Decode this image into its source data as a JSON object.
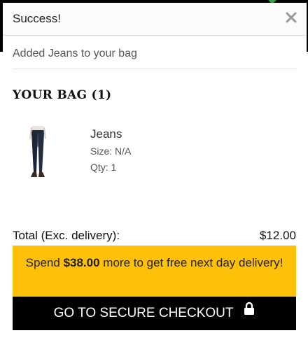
{
  "modal": {
    "title": "Success!",
    "close_glyph": "×",
    "notice": "Added Jeans to your bag"
  },
  "bag": {
    "title": "YOUR BAG (1)",
    "items": [
      {
        "name": "Jeans",
        "size_text": "Size: N/A",
        "qty_text": "Qty: 1",
        "image": "jeans-product-image"
      }
    ]
  },
  "totals": {
    "label": "Total (Exc. delivery):",
    "value": "$12.00"
  },
  "promo": {
    "prefix": "Spend ",
    "amount": "$38.00",
    "suffix": " more to get free next day delivery!"
  },
  "checkout": {
    "label": "GO TO SECURE CHECKOUT",
    "icon": "lock-icon"
  },
  "colors": {
    "promo_bg": "#ffc107",
    "checkout_bg": "#000000",
    "checkout_text": "#ffffff"
  }
}
